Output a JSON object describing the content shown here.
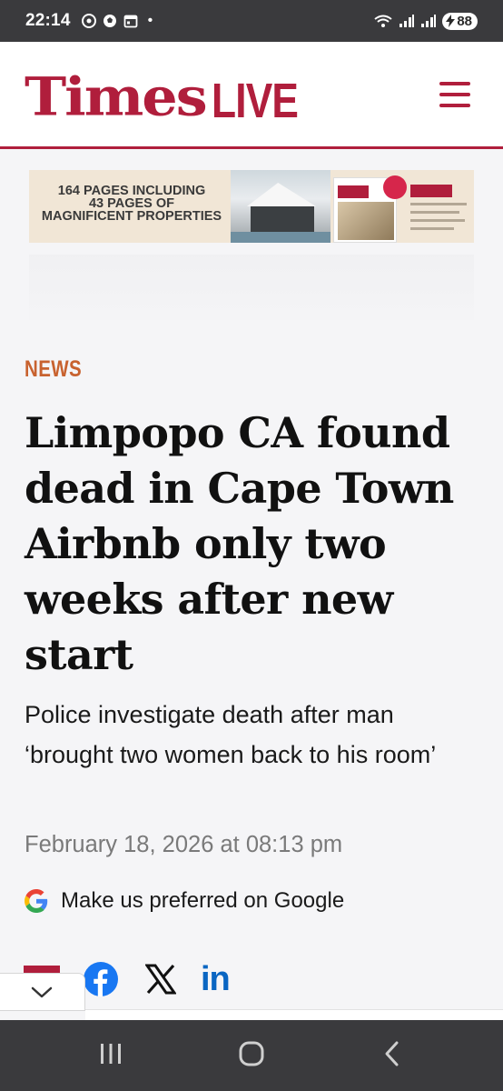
{
  "status_bar": {
    "time": "22:14",
    "dot": "•",
    "battery": "88"
  },
  "header": {
    "logo_times": "Times",
    "logo_live": "LIVE",
    "brand_color": "#b01e3c"
  },
  "ad": {
    "text_line1": "164 PAGES INCLUDING",
    "text_line2": "43 PAGES OF",
    "text_line3": "MAGNIFICENT PROPERTIES"
  },
  "article": {
    "section": "NEWS",
    "section_color": "#c8622f",
    "headline": "Limpopo CA found dead in Cape Town Airbnb only two weeks after new start",
    "subhead": "Police investigate death after man ‘brought two women back to his room’",
    "date": "February 18, 2026 at 08:13 pm"
  },
  "google_pref": {
    "label": "Make us preferred on Google"
  },
  "share": {
    "linkedin_label": "in"
  },
  "icons": [
    "wifi-icon",
    "signal-icon",
    "battery-icon",
    "menu-icon",
    "google-icon",
    "facebook-icon",
    "x-icon",
    "linkedin-icon",
    "chevron-down-icon",
    "recents-icon",
    "home-icon",
    "back-icon"
  ]
}
